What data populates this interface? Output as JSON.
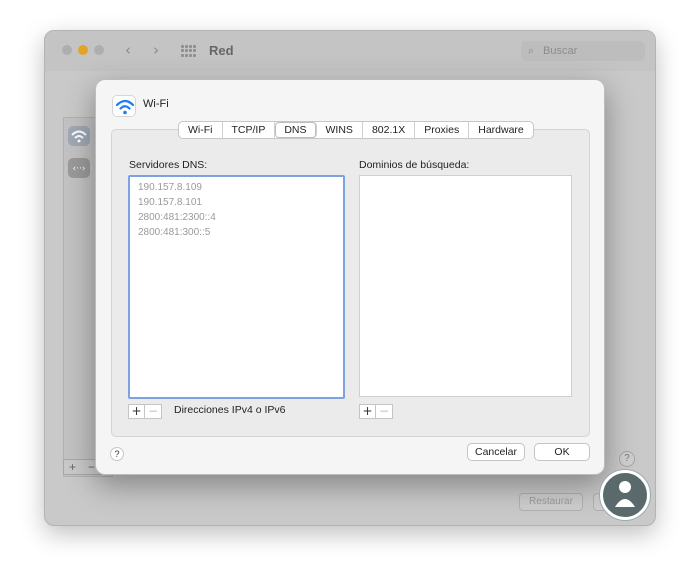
{
  "window": {
    "title": "Red",
    "search_placeholder": "Buscar",
    "restore_label": "Restaurar",
    "help_label": "?"
  },
  "sheet": {
    "title": "Wi-Fi",
    "tabs": [
      "Wi-Fi",
      "TCP/IP",
      "DNS",
      "WINS",
      "802.1X",
      "Proxies",
      "Hardware"
    ],
    "active_tab": "DNS",
    "dns_label": "Servidores DNS:",
    "domains_label": "Dominios de búsqueda:",
    "dns_servers": [
      "190.157.8.109",
      "190.157.8.101",
      "2800:481:2300::4",
      "2800:481:300::5"
    ],
    "hint": "Direcciones IPv4 o IPv6",
    "plus": "+",
    "minus": "−",
    "help": "?",
    "cancel_label": "Cancelar",
    "ok_label": "OK"
  },
  "colors": {
    "focus_ring": "#7da2e1",
    "wifi_icon": "#1f7cf5"
  },
  "icons": [
    "wifi-icon",
    "ethernet-icon",
    "search-icon",
    "grid-icon",
    "back-arrow-icon",
    "forward-arrow-icon"
  ]
}
